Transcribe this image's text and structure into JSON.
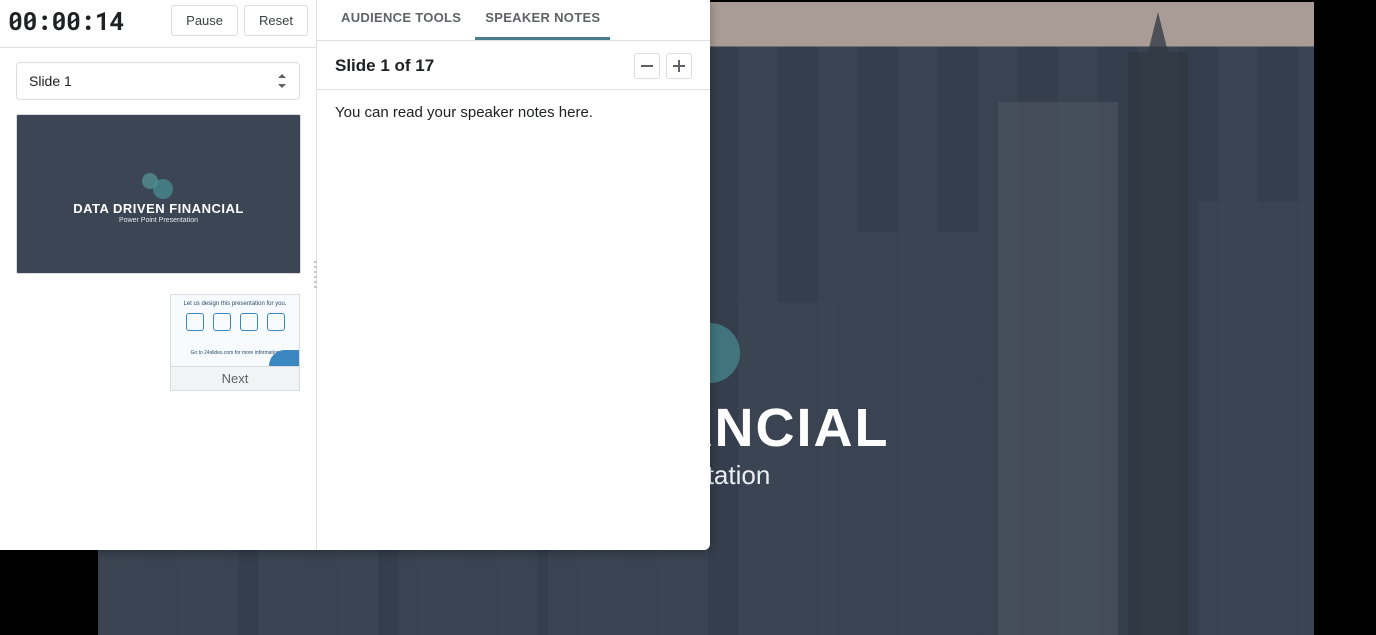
{
  "timer": {
    "elapsed": "00:00:14",
    "pause_label": "Pause",
    "reset_label": "Reset"
  },
  "slide_select": {
    "current_label": "Slide 1"
  },
  "tabs": {
    "audience_tools": "AUDIENCE TOOLS",
    "speaker_notes": "SPEAKER NOTES"
  },
  "notes": {
    "header": "Slide 1 of 17",
    "body": "You can read your speaker notes here."
  },
  "thumbnail": {
    "current_title": "DATA DRIVEN FINANCIAL",
    "current_subtitle": "Power Point Presentation",
    "next_line1": "Let us design this presentation for you.",
    "next_line2": "Go to 24slides.com for more information",
    "next_label": "Next"
  },
  "main_slide": {
    "title_visible": "N FINANCIAL",
    "subtitle_visible": "resentation"
  },
  "icons": {
    "minus": "minus-icon",
    "plus": "plus-icon",
    "select_arrows": "select-updown-icon"
  },
  "colors": {
    "accent_tab": "#4a7d8c",
    "slide_overlay": "#1c2434",
    "circle_teal": "#5ca6a7"
  }
}
